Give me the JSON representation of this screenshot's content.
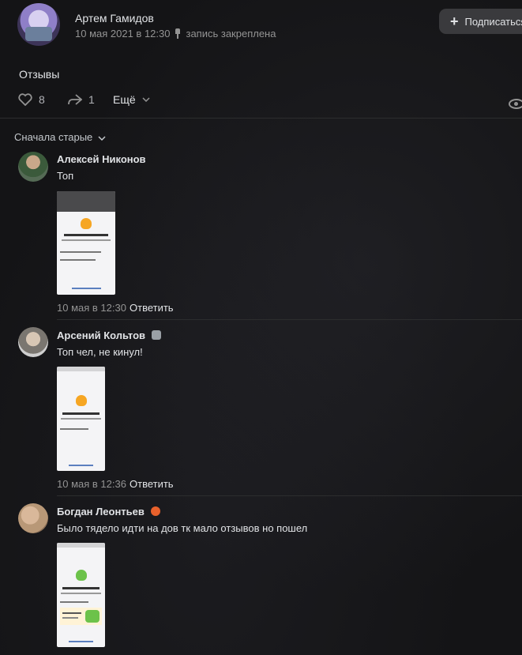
{
  "post": {
    "author": "Артем Гамидов",
    "date": "10 мая 2021 в 12:30",
    "pinned": "запись закреплена",
    "subscribe_label": "Подписаться",
    "text": "Отзывы",
    "likes": "8",
    "shares": "1",
    "more_label": "Ещё"
  },
  "comments_header": {
    "sort_label": "Сначала старые"
  },
  "comments": [
    {
      "name": "Алексей Никонов",
      "text": "Топ",
      "date": "10 мая в 12:30",
      "reply": "Ответить"
    },
    {
      "name": "Арсений Кольтов",
      "text": "Топ чел, не кинул!",
      "date": "10 мая в 12:36",
      "reply": "Ответить"
    },
    {
      "name": "Богдан Леонтьев",
      "text": "Было тядело идти на дов тк мало отзывов но пошел"
    }
  ],
  "colors": {
    "background": "#141416",
    "text": "#e1e3e6",
    "muted": "#939393",
    "divider": "#2c2d2e"
  }
}
